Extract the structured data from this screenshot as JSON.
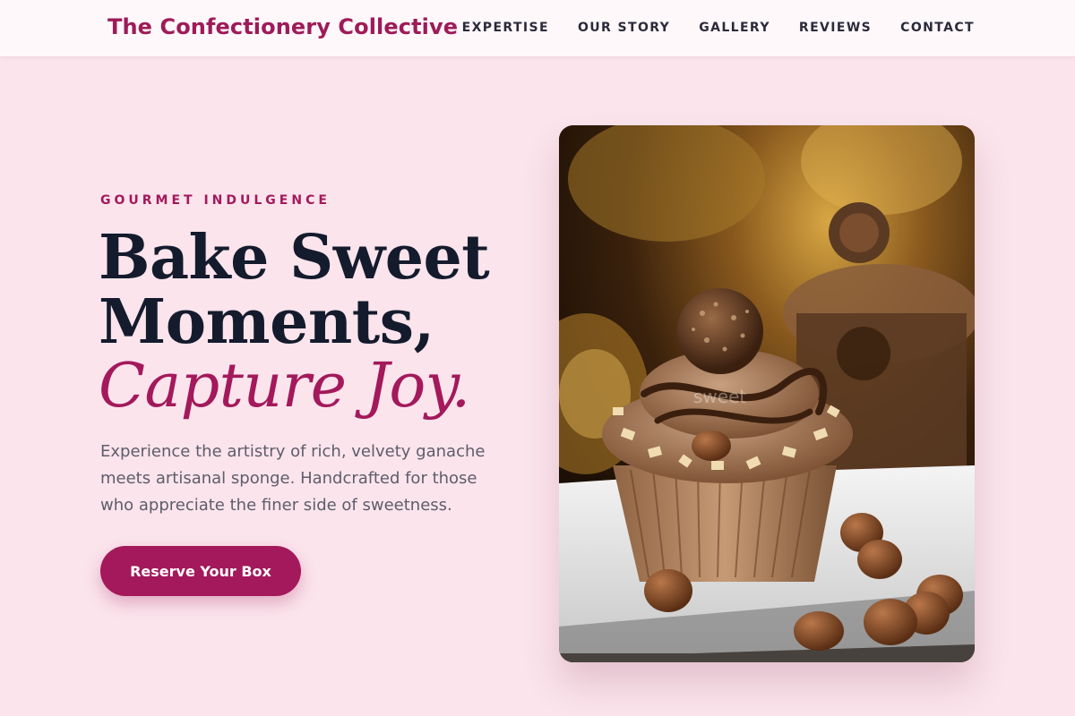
{
  "header": {
    "brand": "The Confectionery Collective",
    "nav": [
      "EXPERTISE",
      "OUR STORY",
      "GALLERY",
      "REVIEWS",
      "CONTACT"
    ]
  },
  "hero": {
    "eyebrow": "GOURMET INDULGENCE",
    "headline_line1": "Bake Sweet",
    "headline_line2": "Moments,",
    "headline_accent": "Capture Joy.",
    "description": "Experience the artistry of rich, velvety ganache meets artisanal sponge. Handcrafted for those who appreciate the finer side of sweetness.",
    "cta_label": "Reserve Your Box",
    "image_watermark": "sweet"
  },
  "colors": {
    "accent": "#a3195b",
    "background": "#fbe4ec",
    "heading": "#141b2d"
  }
}
